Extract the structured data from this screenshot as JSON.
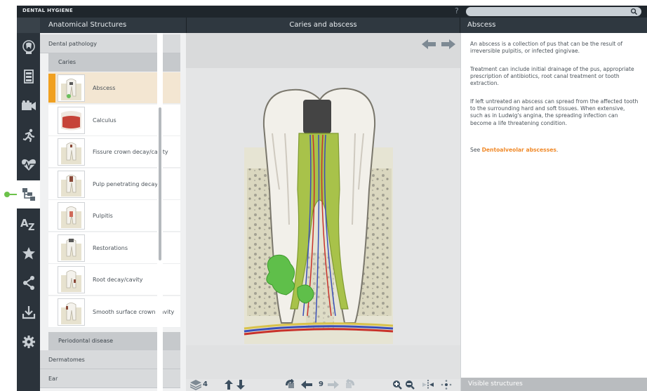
{
  "app": {
    "title": "DENTAL HYGIENE",
    "help": "?"
  },
  "panels": {
    "left_title": "Anatomical Structures",
    "center_title": "Caries and abscess",
    "right_title": "Abscess"
  },
  "rail": {
    "icons": [
      "tooth-icon",
      "book-icon",
      "video-icon",
      "running-man-icon",
      "heartbeat-icon",
      "hierarchy-icon",
      "az-icon",
      "star-icon",
      "share-icon",
      "download-icon",
      "gear-icon"
    ],
    "active_index": 5,
    "active_color": "#6cc24a"
  },
  "tree": {
    "category": "Dental pathology",
    "subcategory": "Caries",
    "items": [
      {
        "label": "Abscess",
        "selected": true
      },
      {
        "label": "Calculus",
        "selected": false
      },
      {
        "label": "Fissure crown decay/cavity",
        "selected": false
      },
      {
        "label": "Pulp penetrating decay",
        "selected": false
      },
      {
        "label": "Pulpitis",
        "selected": false
      },
      {
        "label": "Restorations",
        "selected": false
      },
      {
        "label": "Root decay/cavity",
        "selected": false
      },
      {
        "label": "Smooth surface crown cavity",
        "selected": false
      }
    ],
    "after": [
      {
        "label": "Periodontal disease",
        "level": "subcategory"
      },
      {
        "label": "Dermatomes",
        "level": "category"
      },
      {
        "label": "Ear",
        "level": "category"
      }
    ]
  },
  "toolbar": {
    "layers_count": "4",
    "step": "9"
  },
  "info": {
    "paragraphs": [
      "An abscess is a collection of pus that can be the result of irreversible pulpitis, or infected gingivae.",
      "Treatment can include initial drainage of the pus, appropriate prescription of antibiotics, root canal treatment or tooth extraction.",
      "If left untreated an abscess can spread from the affected tooth to the surrounding hard and soft tissues. When extensive, such as in Ludwig's angina, the spreading infection can become a life threatening condition."
    ],
    "see_prefix": "See ",
    "see_link": "Dentoalveolar abscesses",
    "see_suffix": ".",
    "visible_structures": "Visible structures"
  },
  "colors": {
    "accent": "#f08a2a",
    "selection_bar": "#f0a020",
    "dark": "#2b333b"
  }
}
